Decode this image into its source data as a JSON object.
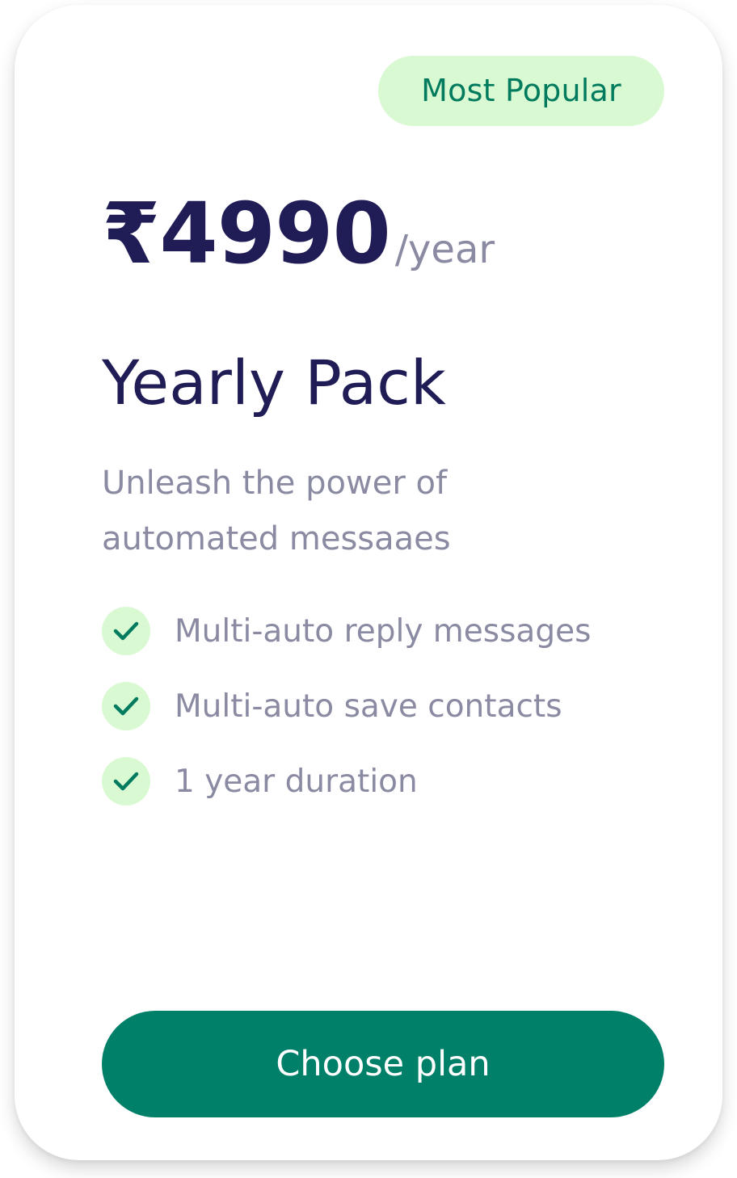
{
  "plan": {
    "badge": "Most Popular",
    "price": "₹4990",
    "period": "/year",
    "name": "Yearly Pack",
    "description": "Unleash the power of automated messaaes",
    "features": [
      {
        "label": "Multi-auto reply messages",
        "icon": "check-icon"
      },
      {
        "label": "Multi-auto save contacts",
        "icon": "check-icon"
      },
      {
        "label": "1 year duration",
        "icon": "check-icon"
      }
    ],
    "cta_label": "Choose plan"
  },
  "colors": {
    "accent": "#008068",
    "badge_bg": "#d9f9d3",
    "badge_text": "#007b5e",
    "heading": "#201c56",
    "muted_text": "#8a8aa3"
  }
}
